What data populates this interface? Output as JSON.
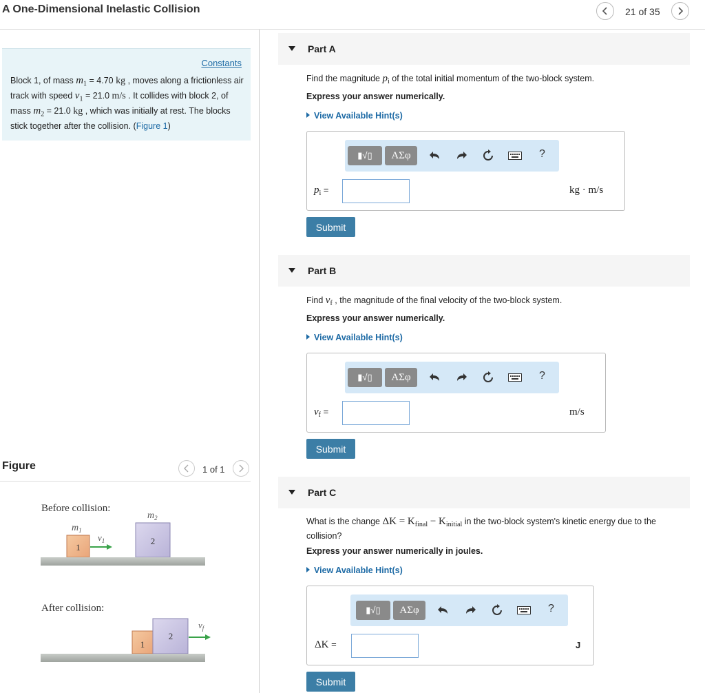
{
  "header": {
    "title": "A One-Dimensional Inelastic Collision",
    "counter": "21 of 35"
  },
  "statement": {
    "constants_link": "Constants",
    "t1": "Block 1, of mass ",
    "m1_sym": "m",
    "m1_sub": "1",
    "m1_val": " = 4.70 ",
    "kg": "kg",
    "t2": " , moves along a frictionless air track with speed ",
    "v1_sym": "v",
    "v1_sub": "1",
    "v1_val": " = 21.0 ",
    "ms": "m/s",
    "t3": " . It collides with block 2, of mass ",
    "m2_sym": "m",
    "m2_sub": "2",
    "m2_val": " = 21.0 ",
    "kg2": "kg",
    "t4": " , which was initially at rest. The blocks stick together after the collision. (",
    "figure_link": "Figure 1",
    "t5": ")"
  },
  "figure": {
    "label": "Figure",
    "counter": "1 of 1",
    "before_label": "Before collision:",
    "after_label": "After collision:",
    "m1_label": "m",
    "m1_sub": "1",
    "m2_label": "m",
    "m2_sub": "2",
    "v1_label": "v",
    "v1_sub": "1",
    "vf_label": "v",
    "vf_sub": "f",
    "block1": "1",
    "block2": "2"
  },
  "toolbar": {
    "templates_label": "▮√▯",
    "greek_label": "ΑΣφ",
    "help_label": "?"
  },
  "parts": [
    {
      "label": "Part A",
      "q_pre": "Find the magnitude ",
      "q_sym": "p",
      "q_sub": "i",
      "q_post": " of the total initial momentum of the two-block system.",
      "express": "Express your answer numerically.",
      "hint": "View Available Hint(s)",
      "var_sym": "p",
      "var_sub": "i",
      "var_eq": " =",
      "unit": "kg · m/s",
      "value": "",
      "submit": "Submit"
    },
    {
      "label": "Part B",
      "q_pre": "Find ",
      "q_sym": "v",
      "q_sub": "f",
      "q_post": " , the magnitude of the final velocity of the two-block system.",
      "express": "Express your answer numerically.",
      "hint": "View Available Hint(s)",
      "var_sym": "v",
      "var_sub": "f",
      "var_eq": " =",
      "unit": "m/s",
      "value": "",
      "submit": "Submit"
    },
    {
      "label": "Part C",
      "q_pre": "What is the change ",
      "q_delta": "ΔK = K",
      "q_final": "final",
      "q_minus": " − K",
      "q_initial": "initial",
      "q_post": " in the two-block system's kinetic energy due to the collision?",
      "express": "Express your answer numerically in joules.",
      "hint": "View Available Hint(s)",
      "var_sym": "ΔK",
      "var_eq": " =",
      "unit": "J",
      "value": "",
      "submit": "Submit"
    }
  ]
}
